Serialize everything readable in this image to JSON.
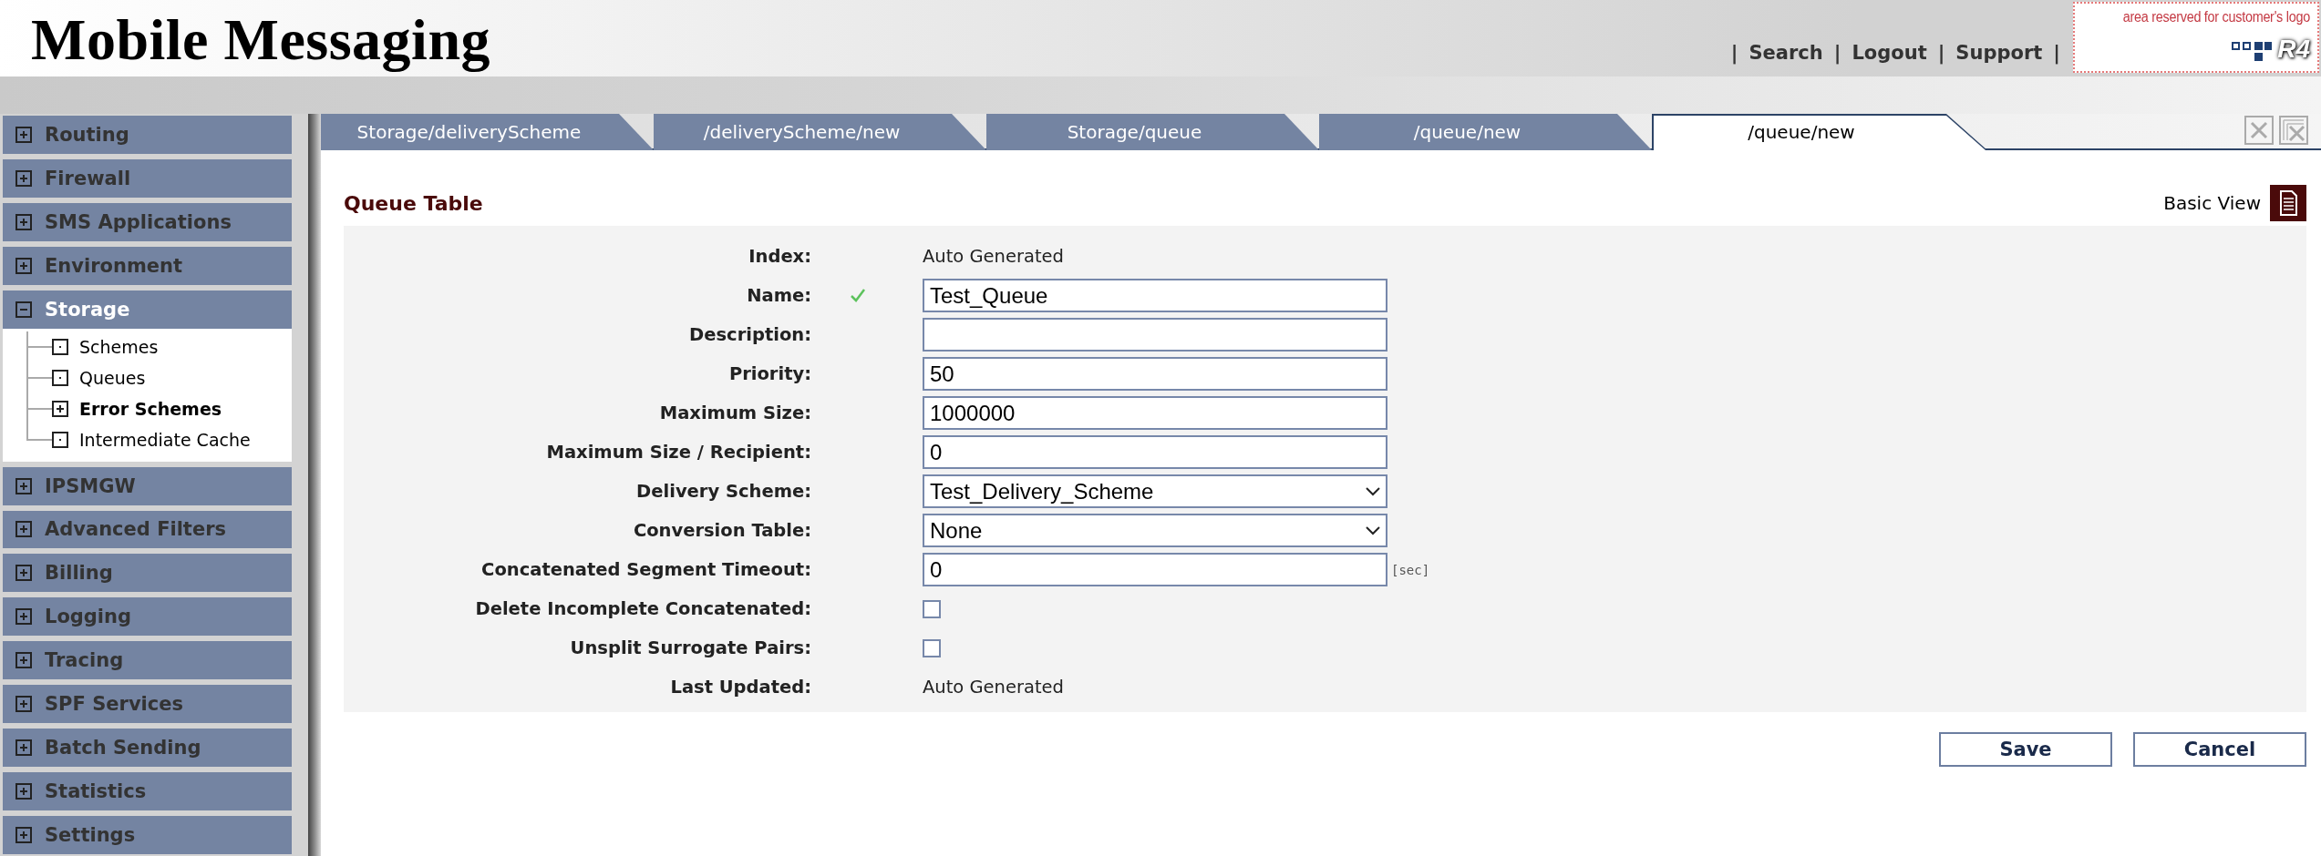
{
  "header": {
    "title": "Mobile Messaging",
    "separator": "|",
    "links": [
      "Search",
      "Logout",
      "Support"
    ],
    "logo_area": {
      "caption": "area reserved for customer's logo",
      "logo_text": "R4"
    }
  },
  "sidebar": {
    "items": [
      {
        "label": "Routing",
        "expanded": false
      },
      {
        "label": "Firewall",
        "expanded": false
      },
      {
        "label": "SMS Applications",
        "expanded": false
      },
      {
        "label": "Environment",
        "expanded": false
      },
      {
        "label": "Storage",
        "expanded": true,
        "children": [
          {
            "label": "Schemes",
            "kind": "leaf",
            "selected": false
          },
          {
            "label": "Queues",
            "kind": "leaf",
            "selected": false
          },
          {
            "label": "Error Schemes",
            "kind": "folder",
            "selected": true
          },
          {
            "label": "Intermediate Cache",
            "kind": "leaf",
            "selected": false
          }
        ]
      },
      {
        "label": "IPSMGW",
        "expanded": false
      },
      {
        "label": "Advanced Filters",
        "expanded": false
      },
      {
        "label": "Billing",
        "expanded": false
      },
      {
        "label": "Logging",
        "expanded": false
      },
      {
        "label": "Tracing",
        "expanded": false
      },
      {
        "label": "SPF Services",
        "expanded": false
      },
      {
        "label": "Batch Sending",
        "expanded": false
      },
      {
        "label": "Statistics",
        "expanded": false
      },
      {
        "label": "Settings",
        "expanded": false
      }
    ]
  },
  "tabs": [
    {
      "label": "Storage/deliveryScheme",
      "selected": false
    },
    {
      "label": "/deliveryScheme/new",
      "selected": false
    },
    {
      "label": "Storage/queue",
      "selected": false
    },
    {
      "label": "/queue/new",
      "selected": false
    },
    {
      "label": "/queue/new",
      "selected": true
    }
  ],
  "form": {
    "title": "Queue Table",
    "view_toggle": "Basic View",
    "fields": [
      {
        "label": "Index:",
        "kind": "text",
        "value": "Auto Generated",
        "valid": false
      },
      {
        "label": "Name:",
        "kind": "input",
        "value": "Test_Queue",
        "valid": true
      },
      {
        "label": "Description:",
        "kind": "input",
        "valid": false
      },
      {
        "label": "Priority:",
        "kind": "input",
        "value": "50",
        "valid": false
      },
      {
        "label": "Maximum Size:",
        "kind": "input",
        "value": "1000000",
        "valid": false
      },
      {
        "label": "Maximum Size / Recipient:",
        "kind": "input",
        "value": "0",
        "valid": false
      },
      {
        "label": "Delivery Scheme:",
        "kind": "select",
        "value": "Test_Delivery_Scheme",
        "valid": false
      },
      {
        "label": "Conversion Table:",
        "kind": "select",
        "value": "None",
        "valid": false
      },
      {
        "label": "Concatenated Segment Timeout:",
        "kind": "input",
        "value": "0",
        "unit": "[sec]",
        "valid": false
      },
      {
        "label": "Delete Incomplete Concatenated:",
        "kind": "checkbox",
        "checked": false,
        "valid": false
      },
      {
        "label": "Unsplit Surrogate Pairs:",
        "kind": "checkbox",
        "checked": false,
        "valid": false
      },
      {
        "label": "Last Updated:",
        "kind": "text",
        "value": "Auto Generated",
        "valid": false
      }
    ],
    "buttons": [
      "Save",
      "Cancel"
    ]
  }
}
